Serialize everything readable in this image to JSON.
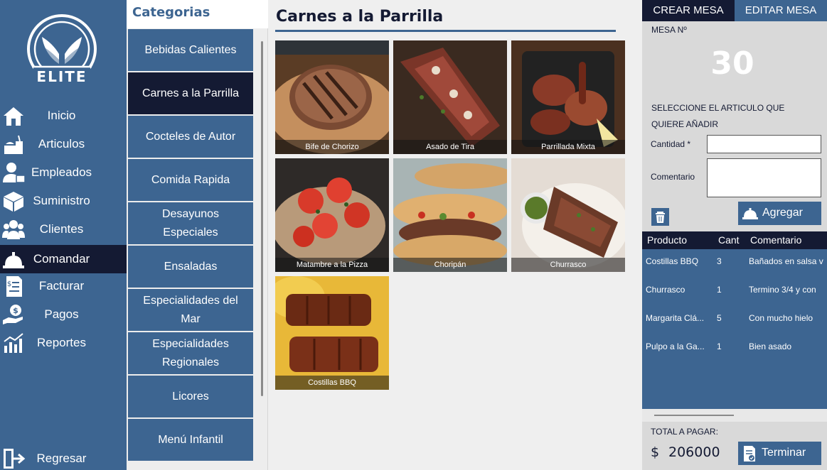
{
  "brand": {
    "logo_text": "ELITE"
  },
  "nav": {
    "items": [
      {
        "label": "Inicio",
        "icon": "home-icon"
      },
      {
        "label": "Articulos",
        "icon": "food-icon"
      },
      {
        "label": "Empleados",
        "icon": "employees-icon"
      },
      {
        "label": "Suministro",
        "icon": "box-icon"
      },
      {
        "label": "Clientes",
        "icon": "clients-icon"
      },
      {
        "label": "Comandar",
        "icon": "service-bell-icon",
        "active": true
      },
      {
        "label": "Facturar",
        "icon": "invoice-icon"
      },
      {
        "label": "Pagos",
        "icon": "payment-icon"
      },
      {
        "label": "Reportes",
        "icon": "reports-icon"
      }
    ],
    "back_label": "Regresar"
  },
  "categories": {
    "title": "Categorias",
    "items": [
      {
        "lines": [
          "Bebidas Calientes"
        ]
      },
      {
        "lines": [
          "Carnes a la Parrilla"
        ],
        "active": true
      },
      {
        "lines": [
          "Cocteles de Autor"
        ]
      },
      {
        "lines": [
          "Comida Rapida"
        ]
      },
      {
        "lines": [
          "Desayunos",
          "Especiales"
        ]
      },
      {
        "lines": [
          "Ensaladas"
        ]
      },
      {
        "lines": [
          "Especialidades del",
          "Mar"
        ]
      },
      {
        "lines": [
          "Especialidades",
          "Regionales"
        ]
      },
      {
        "lines": [
          "Licores"
        ]
      },
      {
        "lines": [
          "Menú Infantil"
        ]
      }
    ]
  },
  "products": {
    "section_title": "Carnes a la Parrilla",
    "items": [
      {
        "name": "Bife de Chorizo"
      },
      {
        "name": "Asado de Tira"
      },
      {
        "name": "Parrillada Mixta"
      },
      {
        "name": "Matambre a la Pizza"
      },
      {
        "name": "Choripán"
      },
      {
        "name": "Churrasco"
      },
      {
        "name": "Costillas BBQ"
      }
    ]
  },
  "order": {
    "tabs": {
      "create": "CREAR MESA",
      "edit": "EDITAR MESA"
    },
    "table_label": "MESA Nº",
    "table_number": "30",
    "instruction_line1": "SELECCIONE EL ARTICULO QUE",
    "instruction_line2": "QUIERE AÑADIR",
    "quantity_label": "Cantidad *",
    "quantity_value": "",
    "comment_label": "Comentario",
    "comment_value": "",
    "add_label": "Agregar",
    "columns": {
      "product": "Producto",
      "qty": "Cant",
      "comment": "Comentario"
    },
    "rows": [
      {
        "product": "Costillas BBQ",
        "qty": "3",
        "comment": "Bañados en salsa v"
      },
      {
        "product": "Churrasco",
        "qty": "1",
        "comment": "Termino 3/4 y con"
      },
      {
        "product": "Margarita Clá...",
        "qty": "5",
        "comment": "Con mucho hielo"
      },
      {
        "product": "Pulpo a la Ga...",
        "qty": "1",
        "comment": "Bien asado"
      }
    ],
    "total_label": "TOTAL A PAGAR:",
    "total_currency": "$",
    "total_value": "206000",
    "finish_label": "Terminar"
  },
  "colors": {
    "primary": "#3d6591",
    "dark": "#141a33",
    "panel_bg": "#d9d9d9",
    "content_bg": "#efefef"
  }
}
